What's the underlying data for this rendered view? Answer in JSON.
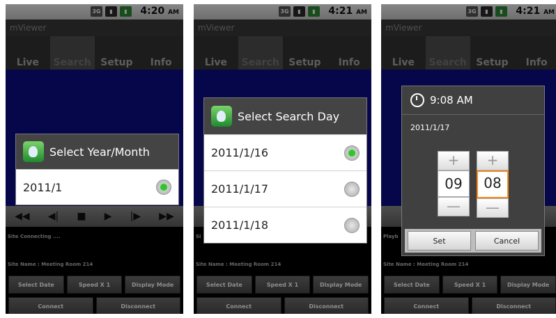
{
  "status_bar": {
    "time": "4:20",
    "ampm": "AM",
    "network": "3G"
  },
  "status_bar_2": {
    "time": "4:21",
    "ampm": "AM"
  },
  "app": {
    "title": "mViewer",
    "tabs": [
      "Live",
      "Search",
      "Setup",
      "Info"
    ],
    "active_tab": "Search",
    "playback_buttons": [
      "rewind",
      "step-back",
      "stop",
      "play",
      "step-forward",
      "fast-forward"
    ],
    "site_connecting": "Site Connecting ....",
    "site_name": "Site Name : Meeting Room 214",
    "buttons_row1": [
      "Select Date",
      "Speed X 1",
      "Display Mode"
    ],
    "buttons_row2": [
      "Connect",
      "Disconnect"
    ],
    "playback_partial_2": "Si",
    "playback_partial_3": "Playb"
  },
  "dialog_year_month": {
    "title": "Select Year/Month",
    "options": [
      "2011/1"
    ],
    "selected": "2011/1"
  },
  "dialog_search_day": {
    "title": "Select Search Day",
    "options": [
      "2011/1/16",
      "2011/1/17",
      "2011/1/18"
    ],
    "selected": "2011/1/16"
  },
  "time_picker": {
    "title": "9:08 AM",
    "date": "2011/1/17",
    "hour": "09",
    "minute": "08",
    "increment_symbol": "+",
    "decrement_symbol": "—",
    "set_label": "Set",
    "cancel_label": "Cancel"
  },
  "colors": {
    "video_bg": "#0b0b88",
    "radio_on": "#34c234",
    "focus_border": "#f28a1c"
  }
}
